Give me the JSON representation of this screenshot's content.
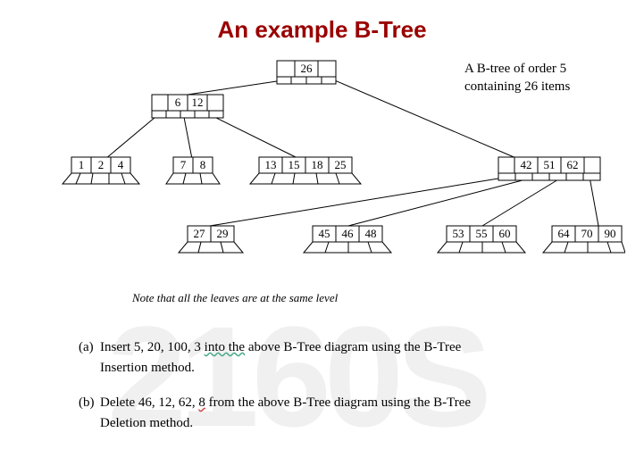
{
  "title": "An example B-Tree",
  "subtitle_l1": "A B-tree of order 5",
  "subtitle_l2": "containing 26 items",
  "note": "Note that all the leaves are at the same level",
  "watermark": "2160S",
  "qa_label": "(a)",
  "qa_l1_pre": "Insert 5, 20, 100, 3 ",
  "qa_l1_und": "into  the",
  "qa_l1_post": " above B-Tree diagram using the B-Tree",
  "qa_l2": "Insertion method.",
  "qb_label": "(b)",
  "qb_l1_pre": "Delete 46, 12, 62, ",
  "qb_l1_und": "8",
  "qb_l1_post": " from the above B-Tree diagram using the B-Tree",
  "qb_l2": "Deletion method.",
  "tree": {
    "root": [
      "26"
    ],
    "level1": {
      "left": [
        "6",
        "12"
      ],
      "right": [
        "42",
        "51",
        "62"
      ]
    },
    "leaves": [
      [
        "1",
        "2",
        "4"
      ],
      [
        "7",
        "8"
      ],
      [
        "13",
        "15",
        "18",
        "25"
      ],
      [
        "27",
        "29"
      ],
      [
        "45",
        "46",
        "48"
      ],
      [
        "53",
        "55",
        "60"
      ],
      [
        "64",
        "70",
        "90"
      ]
    ]
  }
}
